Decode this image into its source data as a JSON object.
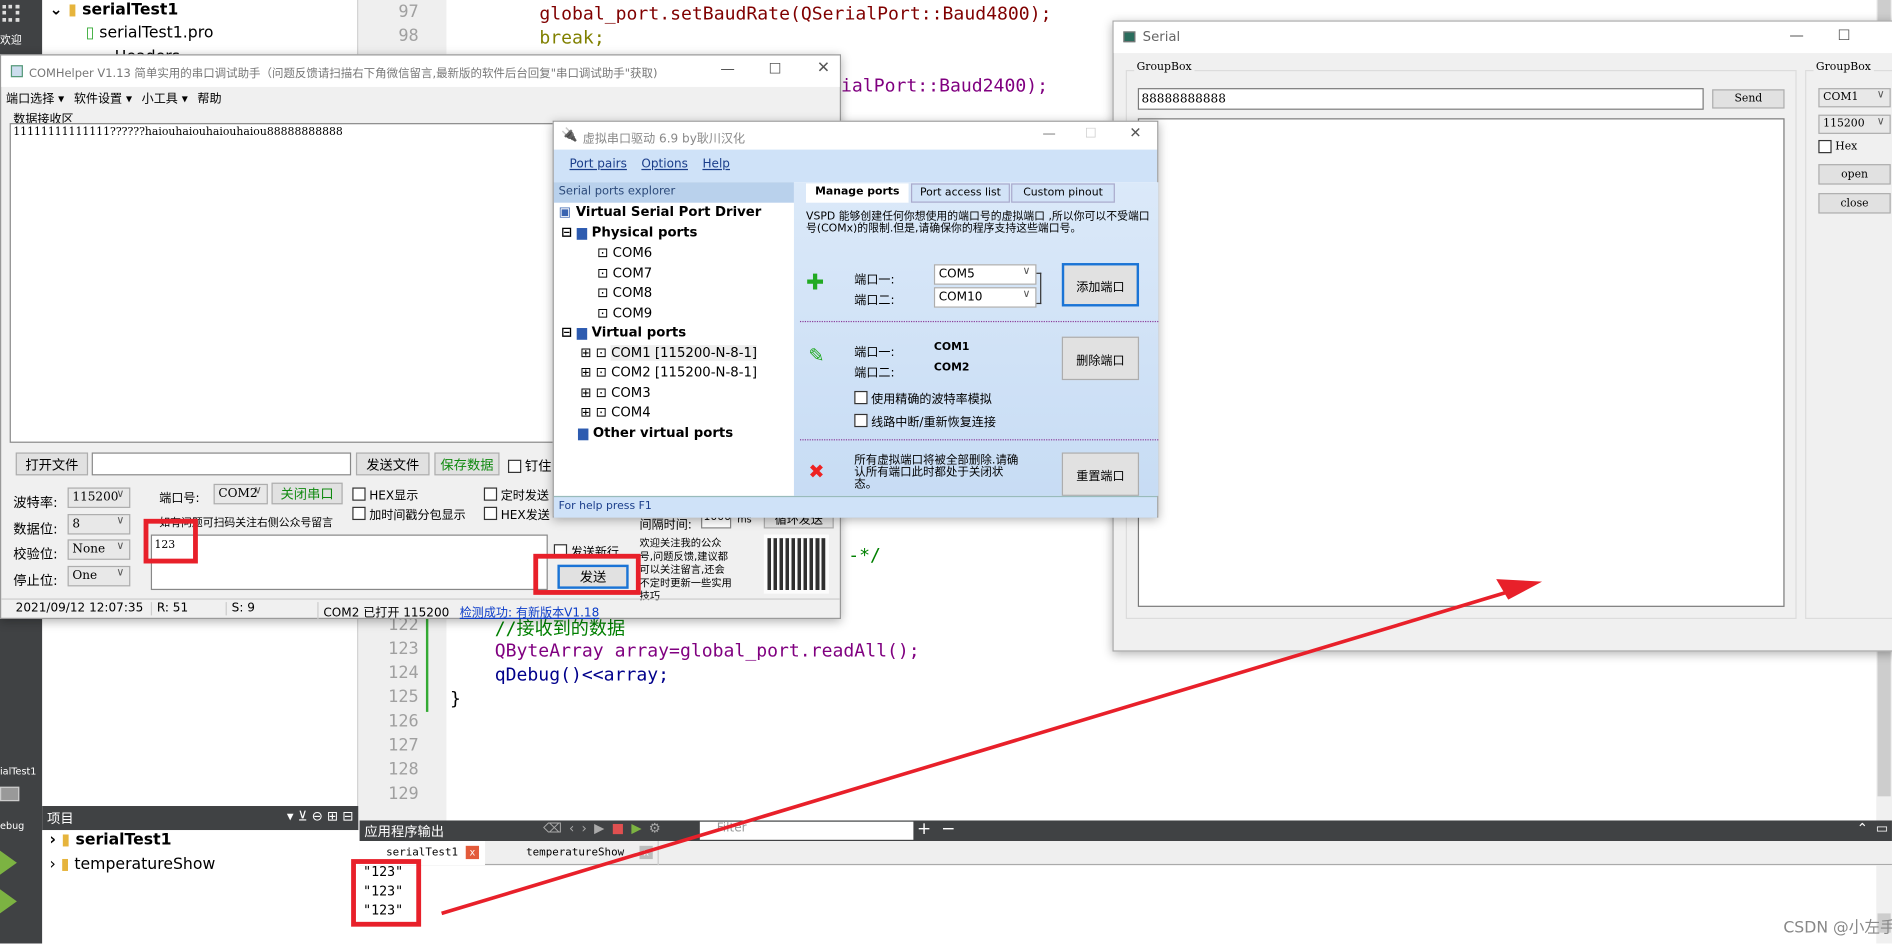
{
  "qtcreator": {
    "sidebar": {
      "welcome": "欢迎",
      "project_label": "ialTest1",
      "debug_label": "ebug"
    },
    "project_tree_top": {
      "root": "serialTest1",
      "pro_file": "serialTest1.pro",
      "headers": "Headers"
    },
    "projects_pane": {
      "title": "项目",
      "items": [
        "serialTest1",
        "temperatureShow"
      ]
    },
    "editor": {
      "lines": [
        {
          "num": "97",
          "text": "global_port.setBaudRate(QSerialPort::Baud4800);"
        },
        {
          "num": "98",
          "text": "break;"
        },
        {
          "num": "",
          "text": "ialPort::Baud2400);"
        },
        {
          "num": "",
          "text": "-*/"
        },
        {
          "num": "122",
          "text": "//接收到的数据"
        },
        {
          "num": "123",
          "text": "QByteArray array=global_port.readAll();"
        },
        {
          "num": "124",
          "text": "qDebug()<<array;"
        },
        {
          "num": "125",
          "text": "}"
        },
        {
          "num": "126",
          "text": ""
        },
        {
          "num": "127",
          "text": ""
        },
        {
          "num": "128",
          "text": ""
        },
        {
          "num": "129",
          "text": ""
        }
      ]
    },
    "output": {
      "title": "应用程序输出",
      "filter_placeholder": "Filter",
      "tabs": [
        "serialTest1",
        "temperatureShow"
      ],
      "lines": [
        "\"123\"",
        "\"123\"",
        "\"123\""
      ]
    }
  },
  "comhelper": {
    "title": "COMHelper V1.13 简单实用的串口调试助手（问题反馈请扫描右下角微信留言,最新版的软件后台回复\"串口调试助手\"获取)",
    "menu": [
      "端口选择",
      "软件设置",
      "小工具",
      "帮助"
    ],
    "receive_label": "数据接收区",
    "received_text": "11111111111111??????haiouhaiouhaiouhaiou88888888888",
    "open_file": "打开文件",
    "send_file": "发送文件",
    "save_data": "保存数据",
    "pin": "钉住",
    "baud_label": "波特率:",
    "baud": "115200",
    "data_bits_label": "数据位:",
    "data_bits": "8",
    "parity_label": "校验位:",
    "parity": "None",
    "stop_label": "停止位:",
    "stop": "One",
    "port_label": "端口号:",
    "port": "COM2",
    "close_port": "关闭串口",
    "hex_display": "HEX显示",
    "timestamp": "加时间戳分包显示",
    "timed_send": "定时发送",
    "hex_send": "HEX发送",
    "interval_label": "间隔时间:",
    "interval": "1000",
    "interval_unit": "ms",
    "loop_send": "循环发送",
    "notice": "如有问题可扫码关注右侧公众号留言",
    "send_text": "123",
    "send_newline": "发送新行",
    "send": "发送",
    "promo": "欢迎关注我的公众号,问题反馈,建议都可以关注留言,还会不定时更新一些实用技巧",
    "status": {
      "time": "2021/09/12 12:07:35",
      "r": "R: 51",
      "s": "S: 9",
      "port_state": "COM2 已打开 115200",
      "update": "检测成功: 有新版本V1.18"
    }
  },
  "vspd": {
    "title": "虚拟串口驱动 6.9 by耿川汉化",
    "menu": [
      "Port pairs",
      "Options",
      "Help"
    ],
    "explorer_title": "Serial ports explorer",
    "tree": {
      "root": "Virtual Serial Port Driver",
      "physical": "Physical ports",
      "physical_ports": [
        "COM6",
        "COM7",
        "COM8",
        "COM9"
      ],
      "virtual": "Virtual ports",
      "virtual_ports": [
        "COM1 [115200-N-8-1]",
        "COM2 [115200-N-8-1]",
        "COM3",
        "COM4"
      ],
      "other": "Other virtual ports"
    },
    "tabs": [
      "Manage ports",
      "Port access list",
      "Custom pinout"
    ],
    "description": "VSPD 能够创建任何你想使用的端口号的虚拟端口 ,所以你可以不受端口号(COMx)的限制.但是,请确保你的程序支持这些端口号。",
    "add": {
      "port1_label": "端口一:",
      "port2_label": "端口二:",
      "port1": "COM5",
      "port2": "COM10",
      "button": "添加端口"
    },
    "delete": {
      "port1_label": "端口一:",
      "port2_label": "端口二:",
      "port1": "COM1",
      "port2": "COM2",
      "button": "删除端口",
      "exact_baud": "使用精确的波特率模拟",
      "line_break": "线路中断/重新恢复连接"
    },
    "reset": {
      "text": "所有虚拟端口将被全部删除.请确认所有端口此时都处于关闭状态。",
      "button": "重置端口"
    },
    "status": "For help press F1"
  },
  "serial_app": {
    "title": "Serial",
    "group1": "GroupBox",
    "input": "88888888888",
    "send": "Send",
    "group2": "GroupBox",
    "port": "COM1",
    "baud": "115200",
    "hex": "Hex",
    "open": "open",
    "close": "close"
  },
  "watermark": "CSDN @小左手",
  "colors": {
    "annotation_red": "#e8202a",
    "qt_dark": "#404244",
    "vspd_blue": "#cfe2f8",
    "link_blue": "#0b3cc9",
    "green_text": "#118a11"
  }
}
